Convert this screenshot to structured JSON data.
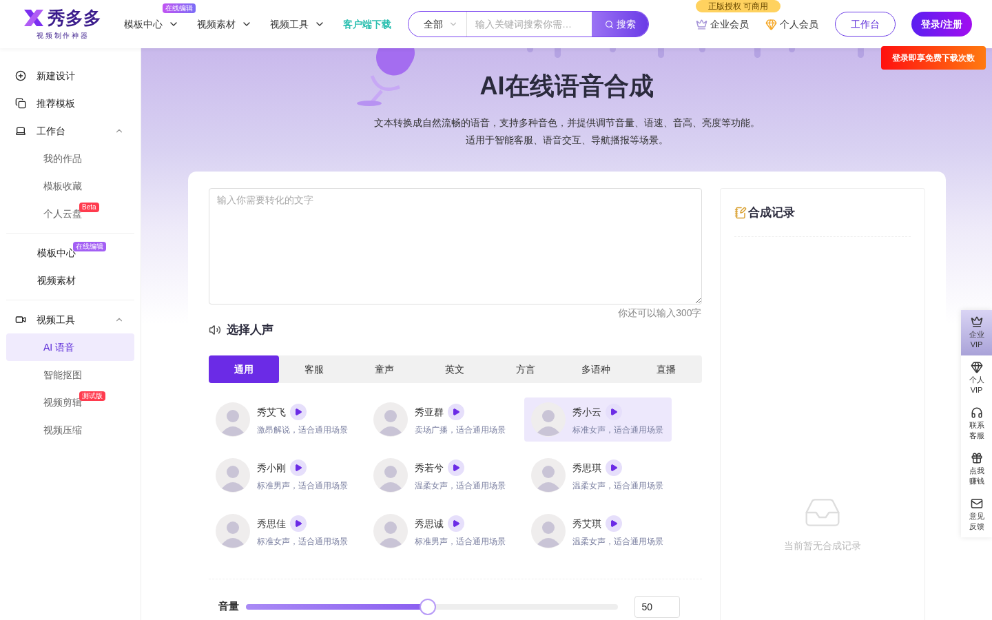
{
  "header": {
    "logo": {
      "name": "秀多多",
      "tagline": "视 频 制 作 神 器"
    },
    "nav": [
      {
        "label": "模板中心",
        "kind": "menu",
        "dropdown": true,
        "badge": "在线编辑"
      },
      {
        "label": "视频素材",
        "kind": "menu",
        "dropdown": true
      },
      {
        "label": "视频工具",
        "kind": "menu",
        "dropdown": true
      },
      {
        "label": "客户端下载",
        "kind": "download",
        "dropdown": false
      }
    ],
    "search": {
      "scope": "全部",
      "placeholder": "输入关键词搜索你需…",
      "button": "搜索"
    },
    "license_badge": "正版授权 可商用",
    "memberships": [
      {
        "label": "企业会员",
        "kind": "enterprise"
      },
      {
        "label": "个人会员",
        "kind": "personal"
      }
    ],
    "workspace_button": "工作台",
    "login_button": "登录/注册",
    "login_tip": "登录即享免费下载次数"
  },
  "sidebar": {
    "groups": [
      {
        "items": [
          {
            "label": "新建设计",
            "kind": "main"
          },
          {
            "label": "推荐模板",
            "kind": "main"
          },
          {
            "label": "工作台",
            "kind": "main",
            "expanded": true,
            "children": [
              {
                "label": "我的作品",
                "selected": false
              },
              {
                "label": "模板收藏",
                "selected": false
              },
              {
                "label": "个人云盘",
                "selected": false,
                "badge": "Beta",
                "color": "#ff3b4e"
              }
            ]
          }
        ]
      },
      {
        "items": [
          {
            "label": "模板中心",
            "kind": "plain",
            "badge": "在线编辑",
            "color": "#a35ff4"
          },
          {
            "label": "视频素材",
            "kind": "plain"
          }
        ]
      },
      {
        "items": [
          {
            "label": "视频工具",
            "kind": "main",
            "expanded": true,
            "children": [
              {
                "label": "AI 语音",
                "selected": true
              },
              {
                "label": "智能抠图",
                "selected": false
              },
              {
                "label": "视频剪辑",
                "selected": false,
                "badge": "测试版",
                "color": "#ff3b4e"
              },
              {
                "label": "视频压缩",
                "selected": false
              }
            ]
          }
        ]
      }
    ]
  },
  "hero": {
    "title": "AI在线语音合成",
    "description": [
      "文本转换成自然流畅的语音，支持多种音色，并提供调节音量、语速、音高、亮度等功能。",
      "适用于智能客服、语音交互、导航播报等场景。"
    ]
  },
  "editor": {
    "placeholder": "输入你需要转化的文字",
    "counter": "你还可以输入300字"
  },
  "voice_section": {
    "title": "选择人声",
    "tabs": [
      {
        "label": "通用",
        "selected": true
      },
      {
        "label": "客服",
        "selected": false
      },
      {
        "label": "童声",
        "selected": false
      },
      {
        "label": "英文",
        "selected": false
      },
      {
        "label": "方言",
        "selected": false
      },
      {
        "label": "多语种",
        "selected": false
      },
      {
        "label": "直播",
        "selected": false
      }
    ],
    "voices": [
      {
        "name": "秀艾飞",
        "description": "激昂解说，适合通用场景",
        "selected": false
      },
      {
        "name": "秀亚群",
        "description": "卖场广播，适合通用场景",
        "selected": false
      },
      {
        "name": "秀小云",
        "description": "标准女声，适合通用场景",
        "selected": true
      },
      {
        "name": "秀小刚",
        "description": "标准男声，适合通用场景",
        "selected": false
      },
      {
        "name": "秀若兮",
        "description": "温柔女声，适合通用场景",
        "selected": false
      },
      {
        "name": "秀思琪",
        "description": "温柔女声，适合通用场景",
        "selected": false
      },
      {
        "name": "秀思佳",
        "description": "标准女声，适合通用场景",
        "selected": false
      },
      {
        "name": "秀思诚",
        "description": "标准男声，适合通用场景",
        "selected": false
      },
      {
        "name": "秀艾琪",
        "description": "温柔女声，适合通用场景",
        "selected": false
      }
    ]
  },
  "volume": {
    "label": "音量",
    "level": 0.49,
    "value": "50"
  },
  "records": {
    "title": "合成记录",
    "empty": "当前暂无合成记录"
  },
  "float_bar": [
    {
      "lines": [
        "企业",
        "VIP"
      ],
      "selected": true
    },
    {
      "lines": [
        "个人",
        "VIP"
      ],
      "selected": false
    },
    {
      "lines": [
        "联系",
        "客服"
      ],
      "selected": false
    },
    {
      "lines": [
        "点我",
        "赚钱"
      ],
      "selected": false
    },
    {
      "lines": [
        "意见",
        "反馈"
      ],
      "selected": false
    }
  ]
}
